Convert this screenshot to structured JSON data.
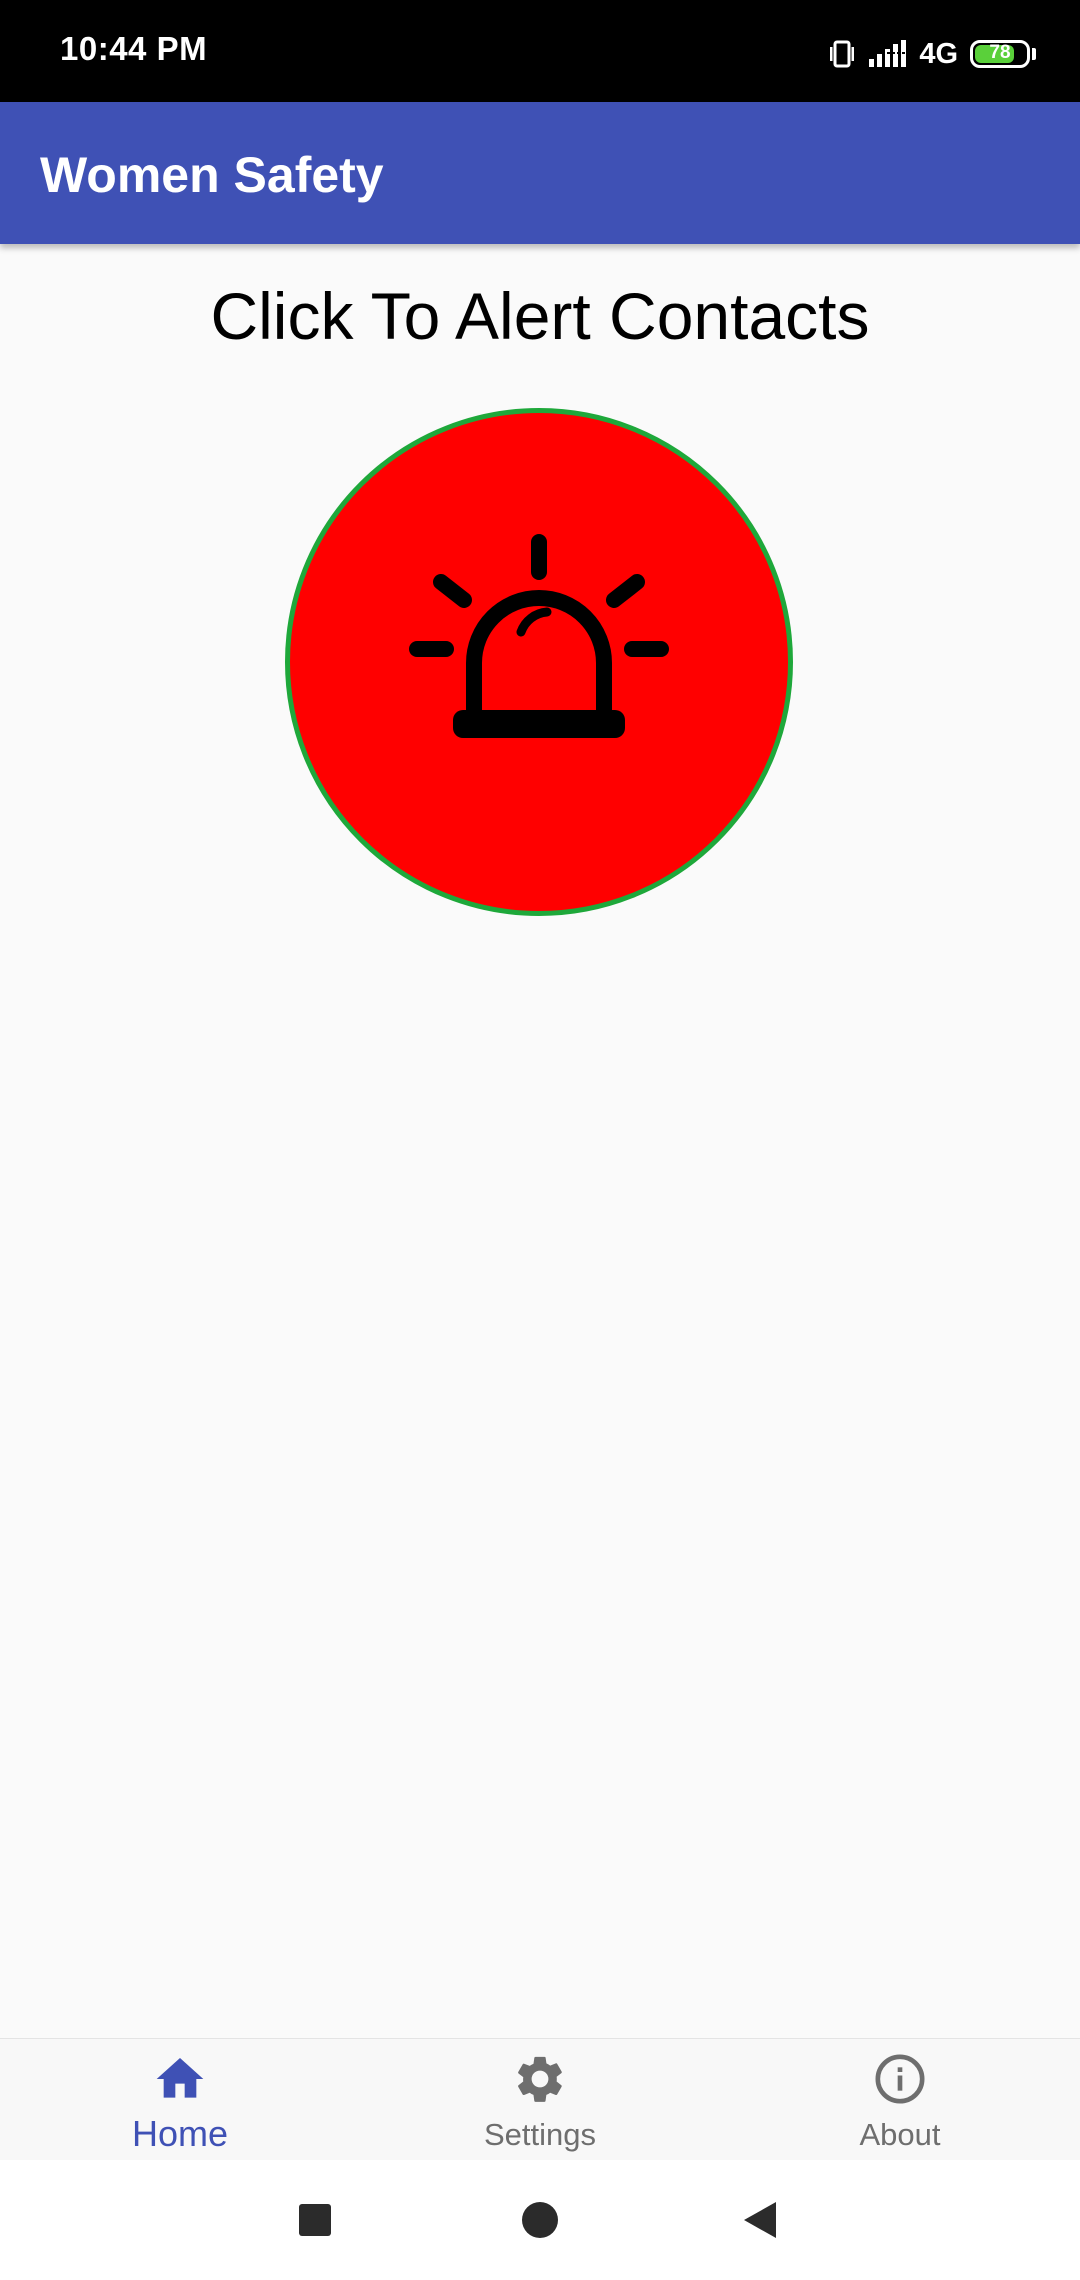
{
  "status_bar": {
    "time": "10:44 PM",
    "network": "4G",
    "battery_level": "78",
    "battery_fraction": 0.78
  },
  "app_bar": {
    "title": "Women Safety"
  },
  "main": {
    "heading": "Click To Alert Contacts",
    "alert_button_icon": "siren-icon"
  },
  "bottom_nav": {
    "items": [
      {
        "label": "Home",
        "icon": "home-icon",
        "active": true
      },
      {
        "label": "Settings",
        "icon": "gear-icon",
        "active": false
      },
      {
        "label": "About",
        "icon": "info-icon",
        "active": false
      }
    ]
  },
  "system_nav": {
    "buttons": [
      "recent-apps",
      "home",
      "back"
    ]
  },
  "colors": {
    "primary": "#3f51b5",
    "alert_red": "#ff0000",
    "alert_border": "#1ea83a",
    "battery_green": "#5ad03a",
    "inactive_nav": "#6e6e6e"
  }
}
